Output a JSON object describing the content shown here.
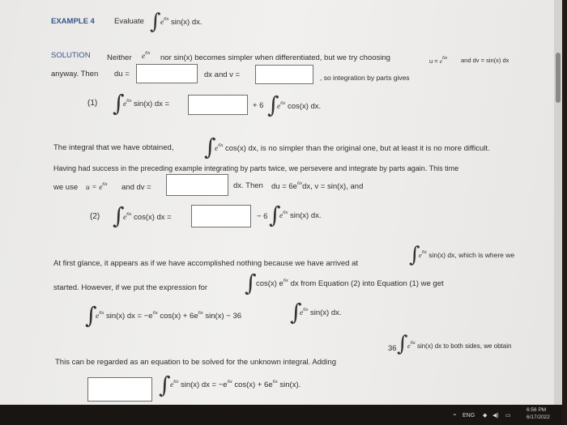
{
  "example": {
    "label": "EXAMPLE 4",
    "evaluate": "Evaluate",
    "integrand": "sin(x) dx."
  },
  "exp": "e",
  "exp6x": "6x",
  "solution": {
    "label": "SOLUTION",
    "text1": "Neither",
    "text2": "nor sin(x) becomes simpler when differentiated, but we try choosing",
    "u_eq": "u =",
    "and_dv": "and dv = sin(x) dx",
    "anyway": "anyway. Then",
    "du": "du =",
    "dx_and_v": "dx  and  v =",
    "so_parts": ", so integration by parts gives"
  },
  "eq1": {
    "num": "(1)",
    "lhs": "sin(x) dx =",
    "plus6": "+ 6",
    "rhs": "cos(x) dx."
  },
  "para2": {
    "a": "The integral that we have obtained,",
    "b": "cos(x) dx,  is no simpler than the original one, but at least it is no more difficult.",
    "c": "Having had success in the preceding example integrating by parts twice, we persevere and integrate by parts again. This time",
    "d": "we use",
    "e": "u =",
    "f": "and  dv =",
    "g": "dx.  Then",
    "h": "du = 6e",
    "i": "dx,  v = sin(x),  and"
  },
  "eq2": {
    "num": "(2)",
    "lhs": "cos(x) dx =",
    "minus6": "− 6",
    "rhs": "sin(x) dx."
  },
  "para3": {
    "a": "At first glance, it appears as if we have accomplished nothing because we have arrived at",
    "b": "sin(x) dx,  which is where we",
    "c": "started. However, if we put the expression for",
    "d": "cos(x) e",
    "e": "dx  from Equation (2) into Equation (1) we get"
  },
  "eq3": {
    "lhs": "sin(x) dx = −e",
    "a": "cos(x) + 6e",
    "b": "sin(x) − 36",
    "c": "sin(x) dx."
  },
  "para4": {
    "a": "This can be regarded as an equation to be solved for the unknown integral. Adding",
    "b": "36",
    "c": "sin(x) dx  to both sides, we obtain"
  },
  "eq4": {
    "lhs": "sin(x) dx = −e",
    "a": "cos(x) + 6e",
    "b": "sin(x)."
  },
  "taskbar": {
    "lang": "ENG",
    "time": "6:56 PM",
    "date": "6/17/2022"
  }
}
